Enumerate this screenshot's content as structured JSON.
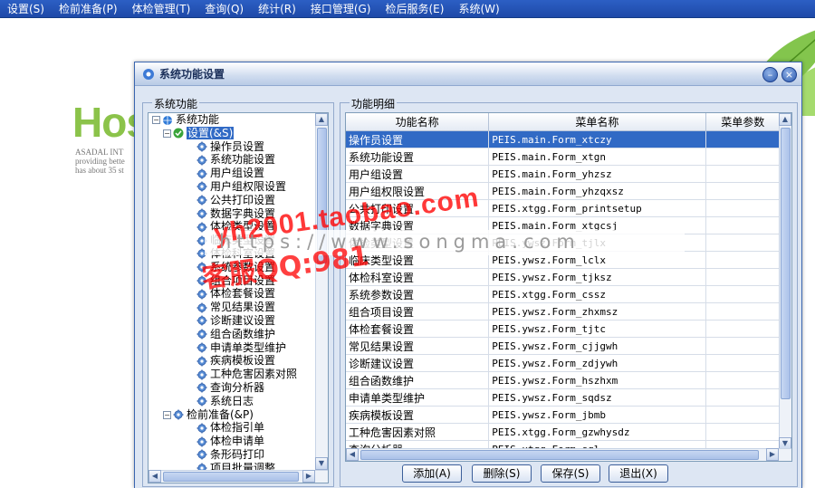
{
  "menubar": {
    "items": [
      "设置(S)",
      "检前准备(P)",
      "体检管理(T)",
      "查询(Q)",
      "统计(R)",
      "接口管理(G)",
      "检后服务(E)",
      "系统(W)"
    ]
  },
  "background": {
    "title": "Hos",
    "lines": [
      "ASADAL INT",
      "providing bette",
      "has about 35 st"
    ]
  },
  "window": {
    "title": "系统功能设置",
    "minimize_glyph": "–",
    "close_glyph": "×"
  },
  "left_panel": {
    "group_label": "系统功能",
    "tree": [
      {
        "label": "系统功能",
        "level": 0,
        "expander": "−",
        "icon": "globe-icon"
      },
      {
        "label": "设置(&S)",
        "level": 1,
        "expander": "−",
        "icon": "check-icon",
        "selected": true
      },
      {
        "label": "操作员设置",
        "level": 2,
        "icon": "gear-icon"
      },
      {
        "label": "系统功能设置",
        "level": 2,
        "icon": "gear-icon"
      },
      {
        "label": "用户组设置",
        "level": 2,
        "icon": "gear-icon"
      },
      {
        "label": "用户组权限设置",
        "level": 2,
        "icon": "gear-icon"
      },
      {
        "label": "公共打印设置",
        "level": 2,
        "icon": "gear-icon"
      },
      {
        "label": "数据字典设置",
        "level": 2,
        "icon": "gear-icon"
      },
      {
        "label": "体检类型设置",
        "level": 2,
        "icon": "gear-icon"
      },
      {
        "label": "临床类型设置",
        "level": 2,
        "icon": "gear-icon"
      },
      {
        "label": "体检科室设置",
        "level": 2,
        "icon": "gear-icon"
      },
      {
        "label": "系统参数设置",
        "level": 2,
        "icon": "gear-icon"
      },
      {
        "label": "组合项目设置",
        "level": 2,
        "icon": "gear-icon"
      },
      {
        "label": "体检套餐设置",
        "level": 2,
        "icon": "gear-icon"
      },
      {
        "label": "常见结果设置",
        "level": 2,
        "icon": "gear-icon"
      },
      {
        "label": "诊断建议设置",
        "level": 2,
        "icon": "gear-icon"
      },
      {
        "label": "组合函数维护",
        "level": 2,
        "icon": "gear-icon"
      },
      {
        "label": "申请单类型维护",
        "level": 2,
        "icon": "gear-icon"
      },
      {
        "label": "疾病模板设置",
        "level": 2,
        "icon": "gear-icon"
      },
      {
        "label": "工种危害因素对照",
        "level": 2,
        "icon": "gear-icon"
      },
      {
        "label": "查询分析器",
        "level": 2,
        "icon": "gear-icon"
      },
      {
        "label": "系统日志",
        "level": 2,
        "icon": "gear-icon"
      },
      {
        "label": "检前准备(&P)",
        "level": 1,
        "expander": "−",
        "icon": "gear-icon"
      },
      {
        "label": "体检指引单",
        "level": 2,
        "icon": "gear-icon"
      },
      {
        "label": "体检申请单",
        "level": 2,
        "icon": "gear-icon"
      },
      {
        "label": "条形码打印",
        "level": 2,
        "icon": "gear-icon"
      },
      {
        "label": "项目批量调整",
        "level": 2,
        "icon": "gear-icon"
      }
    ]
  },
  "right_panel": {
    "group_label": "功能明细",
    "columns": [
      "功能名称",
      "菜单名称",
      "菜单参数"
    ],
    "rows": [
      {
        "name": "操作员设置",
        "menu": "PEIS.main.Form_xtczy",
        "param": "",
        "selected": true
      },
      {
        "name": "系统功能设置",
        "menu": "PEIS.main.Form_xtgn",
        "param": ""
      },
      {
        "name": "用户组设置",
        "menu": "PEIS.main.Form_yhzsz",
        "param": ""
      },
      {
        "name": "用户组权限设置",
        "menu": "PEIS.main.Form_yhzqxsz",
        "param": ""
      },
      {
        "name": "公共打印设置",
        "menu": "PEIS.xtgg.Form_printsetup",
        "param": ""
      },
      {
        "name": "数据字典设置",
        "menu": "PEIS.main.Form_xtgcsj",
        "param": ""
      },
      {
        "name": "体检类型设置",
        "menu": "PEIS.ywsz.Form_tjlx",
        "param": ""
      },
      {
        "name": "临床类型设置",
        "menu": "PEIS.ywsz.Form_lclx",
        "param": ""
      },
      {
        "name": "体检科室设置",
        "menu": "PEIS.ywsz.Form_tjksz",
        "param": ""
      },
      {
        "name": "系统参数设置",
        "menu": "PEIS.xtgg.Form_cssz",
        "param": ""
      },
      {
        "name": "组合项目设置",
        "menu": "PEIS.ywsz.Form_zhxmsz",
        "param": ""
      },
      {
        "name": "体检套餐设置",
        "menu": "PEIS.ywsz.Form_tjtc",
        "param": ""
      },
      {
        "name": "常见结果设置",
        "menu": "PEIS.ywsz.Form_cjjgwh",
        "param": ""
      },
      {
        "name": "诊断建议设置",
        "menu": "PEIS.ywsz.Form_zdjywh",
        "param": ""
      },
      {
        "name": "组合函数维护",
        "menu": "PEIS.ywsz.Form_hszhxm",
        "param": ""
      },
      {
        "name": "申请单类型维护",
        "menu": "PEIS.ywsz.Form_sqdsz",
        "param": ""
      },
      {
        "name": "疾病模板设置",
        "menu": "PEIS.ywsz.Form_jbmb",
        "param": ""
      },
      {
        "name": "工种危害因素对照",
        "menu": "PEIS.xtgg.Form_gzwhysdz",
        "param": ""
      },
      {
        "name": "查询分析器",
        "menu": "PEIS.xtgg.Form_sql",
        "param": ""
      }
    ]
  },
  "buttons": {
    "add": "添加(A)",
    "delete": "删除(S)",
    "save": "保存(S)",
    "exit": "退出(X)"
  },
  "watermark": {
    "top": "yh2001.taobao.com",
    "url": "https://www.songma.com",
    "qq": "客服QQ:981"
  },
  "colors": {
    "menubar": "#1e49a8",
    "selection": "#316ac5",
    "window_bg": "#dde6f3",
    "logo_green": "#8bc34a"
  }
}
